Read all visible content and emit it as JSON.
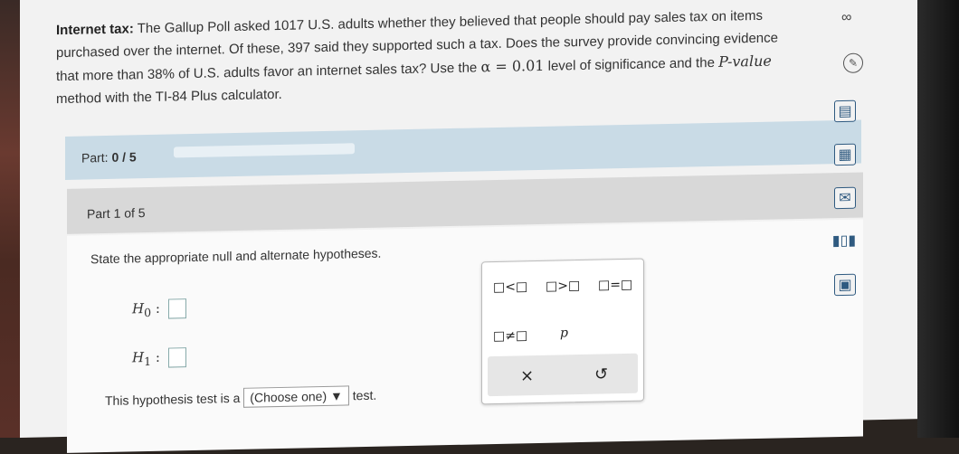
{
  "problem": {
    "title": "Internet tax:",
    "line1": " The Gallup Poll asked 1017 U.S. adults whether they believed that people should pay sales tax on items",
    "line2": "purchased over the internet. Of these, 397 said they supported such a tax. Does the survey provide convincing evidence",
    "line3_a": "that more than 38% of U.S. adults favor an internet sales tax? Use the ",
    "alpha": "α = 0.01",
    "line3_b": " level of significance and the ",
    "pvalue": "P-value",
    "line4": "method with the TI-84 Plus calculator."
  },
  "part_bar": {
    "label_prefix": "Part: ",
    "label_value": "0 / 5",
    "progress_fraction": 0
  },
  "part_header": {
    "text": "Part 1 of 5"
  },
  "content": {
    "instruction": "State the appropriate null and alternate hypotheses.",
    "h0_label": "H",
    "h0_sub": "0",
    "h1_label": "H",
    "h1_sub": "1",
    "colon": ":",
    "test_prefix": "This hypothesis test is a",
    "test_select": "(Choose one)",
    "test_suffix": "test."
  },
  "palette": {
    "lt": "□<□",
    "gt": "□>□",
    "eq": "□=□",
    "ne": "□≠□",
    "p": "p",
    "clear": "×",
    "undo": "↺"
  },
  "icons": {
    "infinity": "∞",
    "pencil": "✎",
    "tools": [
      "calculator-icon",
      "book-icon",
      "mail-icon",
      "chart-icon",
      "data-icon"
    ]
  },
  "colors": {
    "part_bar": "#c9dbe6",
    "accent": "#2f5a80"
  }
}
